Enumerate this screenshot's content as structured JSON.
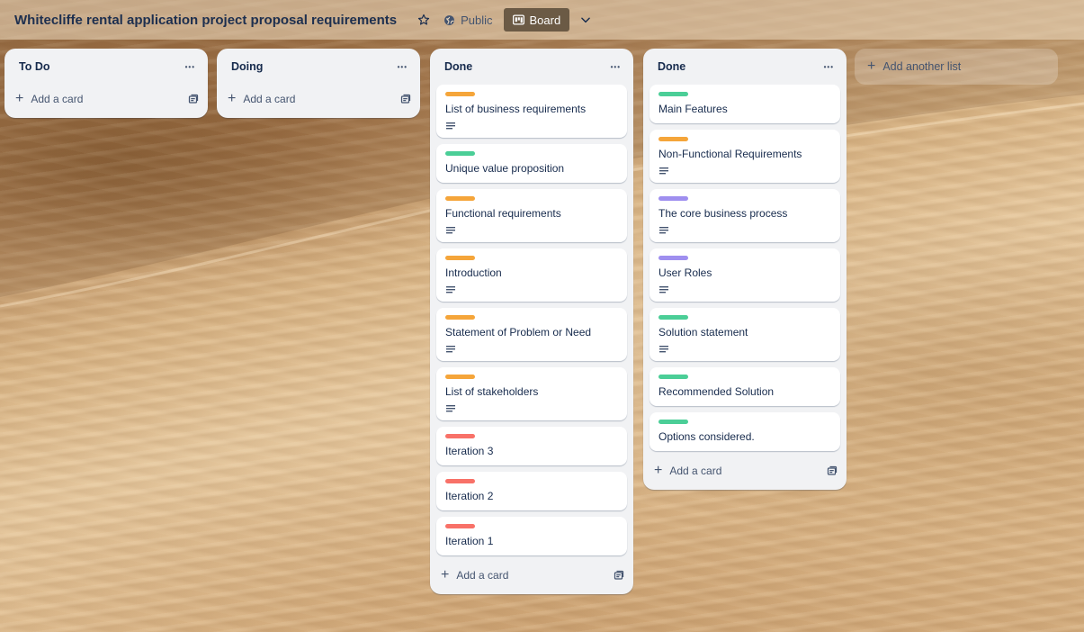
{
  "board": {
    "title": "Whitecliffe rental application project proposal requirements",
    "visibility_label": "Public",
    "view_label": "Board"
  },
  "colors": {
    "orange": "#f5a53a",
    "green": "#4bce97",
    "purple": "#9f8fef",
    "red": "#f87168"
  },
  "lists": [
    {
      "title": "To Do",
      "cards": [],
      "add_card_label": "Add a card"
    },
    {
      "title": "Doing",
      "cards": [],
      "add_card_label": "Add a card"
    },
    {
      "title": "Done",
      "add_card_label": "Add a card",
      "cards": [
        {
          "title": "List of business requirements",
          "label": "orange",
          "has_description": true
        },
        {
          "title": "Unique value proposition",
          "label": "green",
          "has_description": false
        },
        {
          "title": "Functional requirements",
          "label": "orange",
          "has_description": true
        },
        {
          "title": "Introduction",
          "label": "orange",
          "has_description": true
        },
        {
          "title": "Statement of Problem or Need",
          "label": "orange",
          "has_description": true
        },
        {
          "title": "List of stakeholders",
          "label": "orange",
          "has_description": true
        },
        {
          "title": "Iteration 3",
          "label": "red",
          "has_description": false
        },
        {
          "title": "Iteration 2",
          "label": "red",
          "has_description": false
        },
        {
          "title": "Iteration 1",
          "label": "red",
          "has_description": false
        }
      ]
    },
    {
      "title": "Done",
      "add_card_label": "Add a card",
      "cards": [
        {
          "title": "Main Features",
          "label": "green",
          "has_description": false
        },
        {
          "title": "Non-Functional Requirements",
          "label": "orange",
          "has_description": true
        },
        {
          "title": "The core business process",
          "label": "purple",
          "has_description": true
        },
        {
          "title": "User Roles",
          "label": "purple",
          "has_description": true
        },
        {
          "title": "Solution statement",
          "label": "green",
          "has_description": true
        },
        {
          "title": "Recommended Solution",
          "label": "green",
          "has_description": false
        },
        {
          "title": "Options considered.",
          "label": "green",
          "has_description": false
        }
      ]
    }
  ],
  "add_list_label": "Add another list"
}
